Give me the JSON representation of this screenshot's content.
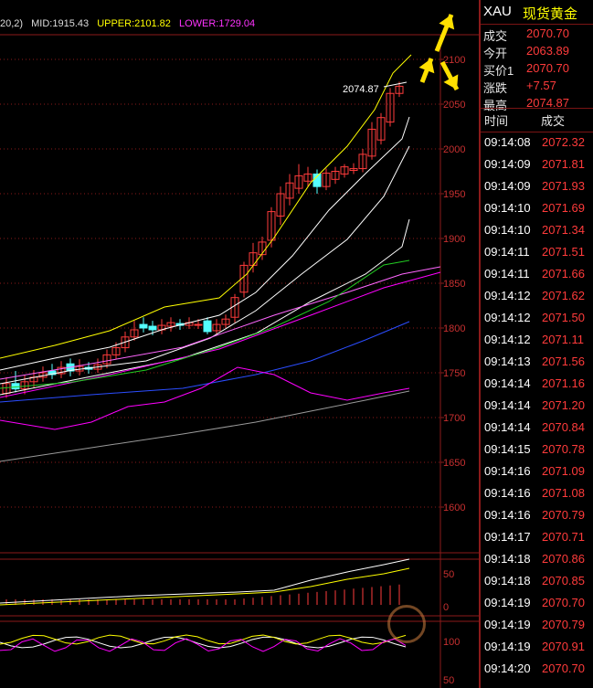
{
  "header": {
    "params": "20,2)",
    "mid_label": "MID:1915.43",
    "upper_label": "UPPER:2101.82",
    "lower_label": "LOWER:1729.04"
  },
  "colors": {
    "background": "#000000",
    "grid": "#8b1a1a",
    "up_candle": "#ff3b3b",
    "down_candle": "#54ffff",
    "mid": "#ffffff",
    "upper": "#ffff00",
    "lower": "#ff00ff",
    "ma_green": "#22cc22",
    "ma_blue": "#2b4dff",
    "ma_gray": "#9a9a9a",
    "ma_pink": "#ff66ff",
    "arrow": "#ffe000"
  },
  "quote": {
    "symbol": "XAU",
    "name": "现货黄金",
    "rows": [
      {
        "label": "成交",
        "value": "2070.70"
      },
      {
        "label": "今开",
        "value": "2063.89"
      },
      {
        "label": "买价1",
        "value": "2070.70"
      },
      {
        "label": "涨跌",
        "value": "+7.57"
      },
      {
        "label": "最高",
        "value": "2074.87"
      }
    ]
  },
  "ticks_header": {
    "time": "时间",
    "price": "成交"
  },
  "ticks": [
    {
      "time": "09:14:08",
      "price": "2072.32"
    },
    {
      "time": "09:14:09",
      "price": "2071.81"
    },
    {
      "time": "09:14:09",
      "price": "2071.93"
    },
    {
      "time": "09:14:10",
      "price": "2071.69"
    },
    {
      "time": "09:14:10",
      "price": "2071.34"
    },
    {
      "time": "09:14:11",
      "price": "2071.51"
    },
    {
      "time": "09:14:11",
      "price": "2071.66"
    },
    {
      "time": "09:14:12",
      "price": "2071.62"
    },
    {
      "time": "09:14:12",
      "price": "2071.50"
    },
    {
      "time": "09:14:12",
      "price": "2071.11"
    },
    {
      "time": "09:14:13",
      "price": "2071.56"
    },
    {
      "time": "09:14:14",
      "price": "2071.16"
    },
    {
      "time": "09:14:14",
      "price": "2071.20"
    },
    {
      "time": "09:14:14",
      "price": "2070.84"
    },
    {
      "time": "09:14:15",
      "price": "2070.78"
    },
    {
      "time": "09:14:16",
      "price": "2071.09"
    },
    {
      "time": "09:14:16",
      "price": "2071.08"
    },
    {
      "time": "09:14:16",
      "price": "2070.79"
    },
    {
      "time": "09:14:17",
      "price": "2070.71"
    },
    {
      "time": "09:14:18",
      "price": "2070.86"
    },
    {
      "time": "09:14:18",
      "price": "2070.85"
    },
    {
      "time": "09:14:19",
      "price": "2070.70"
    },
    {
      "time": "09:14:19",
      "price": "2070.79"
    },
    {
      "time": "09:14:19",
      "price": "2070.91"
    },
    {
      "time": "09:14:20",
      "price": "2070.70"
    }
  ],
  "chart_data": {
    "type": "candlestick",
    "y_axis_ticks": [
      "2100",
      "2050",
      "2000",
      "1950",
      "1900",
      "1850",
      "1800",
      "1750",
      "1700",
      "1650",
      "1600"
    ],
    "high_annotation": "2074.87",
    "candles": [
      {
        "o": 1727,
        "c": 1738,
        "h": 1745,
        "l": 1722
      },
      {
        "o": 1738,
        "c": 1732,
        "h": 1752,
        "l": 1728
      },
      {
        "o": 1732,
        "c": 1740,
        "h": 1748,
        "l": 1726
      },
      {
        "o": 1740,
        "c": 1745,
        "h": 1753,
        "l": 1733
      },
      {
        "o": 1745,
        "c": 1750,
        "h": 1757,
        "l": 1740
      },
      {
        "o": 1752,
        "c": 1748,
        "h": 1760,
        "l": 1743
      },
      {
        "o": 1749,
        "c": 1756,
        "h": 1763,
        "l": 1744
      },
      {
        "o": 1760,
        "c": 1752,
        "h": 1766,
        "l": 1746
      },
      {
        "o": 1752,
        "c": 1757,
        "h": 1765,
        "l": 1747
      },
      {
        "o": 1756,
        "c": 1754,
        "h": 1762,
        "l": 1749
      },
      {
        "o": 1754,
        "c": 1759,
        "h": 1766,
        "l": 1750
      },
      {
        "o": 1760,
        "c": 1770,
        "h": 1776,
        "l": 1755
      },
      {
        "o": 1770,
        "c": 1778,
        "h": 1784,
        "l": 1765
      },
      {
        "o": 1778,
        "c": 1790,
        "h": 1796,
        "l": 1773
      },
      {
        "o": 1790,
        "c": 1798,
        "h": 1808,
        "l": 1786
      },
      {
        "o": 1804,
        "c": 1800,
        "h": 1812,
        "l": 1795
      },
      {
        "o": 1802,
        "c": 1798,
        "h": 1808,
        "l": 1792
      },
      {
        "o": 1798,
        "c": 1803,
        "h": 1810,
        "l": 1793
      },
      {
        "o": 1802,
        "c": 1806,
        "h": 1812,
        "l": 1796
      },
      {
        "o": 1805,
        "c": 1803,
        "h": 1810,
        "l": 1798
      },
      {
        "o": 1803,
        "c": 1806,
        "h": 1812,
        "l": 1799
      },
      {
        "o": 1804,
        "c": 1804,
        "h": 1810,
        "l": 1799
      },
      {
        "o": 1808,
        "c": 1796,
        "h": 1812,
        "l": 1793
      },
      {
        "o": 1797,
        "c": 1804,
        "h": 1810,
        "l": 1793
      },
      {
        "o": 1804,
        "c": 1810,
        "h": 1815,
        "l": 1800
      },
      {
        "o": 1812,
        "c": 1834,
        "h": 1838,
        "l": 1806
      },
      {
        "o": 1840,
        "c": 1870,
        "h": 1874,
        "l": 1834
      },
      {
        "o": 1870,
        "c": 1884,
        "h": 1895,
        "l": 1862
      },
      {
        "o": 1882,
        "c": 1896,
        "h": 1902,
        "l": 1876
      },
      {
        "o": 1898,
        "c": 1930,
        "h": 1935,
        "l": 1890
      },
      {
        "o": 1925,
        "c": 1950,
        "h": 1958,
        "l": 1915
      },
      {
        "o": 1945,
        "c": 1962,
        "h": 1972,
        "l": 1937
      },
      {
        "o": 1956,
        "c": 1970,
        "h": 1983,
        "l": 1950
      },
      {
        "o": 1964,
        "c": 1972,
        "h": 1980,
        "l": 1958
      },
      {
        "o": 1972,
        "c": 1958,
        "h": 1977,
        "l": 1950
      },
      {
        "o": 1958,
        "c": 1973,
        "h": 1978,
        "l": 1954
      },
      {
        "o": 1966,
        "c": 1975,
        "h": 1980,
        "l": 1961
      },
      {
        "o": 1972,
        "c": 1980,
        "h": 1983,
        "l": 1968
      },
      {
        "o": 1976,
        "c": 1978,
        "h": 1984,
        "l": 1972
      },
      {
        "o": 1978,
        "c": 1994,
        "h": 2000,
        "l": 1974
      },
      {
        "o": 1992,
        "c": 2022,
        "h": 2030,
        "l": 1988
      },
      {
        "o": 2010,
        "c": 2035,
        "h": 2040,
        "l": 2005
      },
      {
        "o": 2030,
        "c": 2062,
        "h": 2068,
        "l": 2025
      },
      {
        "o": 2062,
        "c": 2070,
        "h": 2075,
        "l": 2058
      }
    ]
  }
}
